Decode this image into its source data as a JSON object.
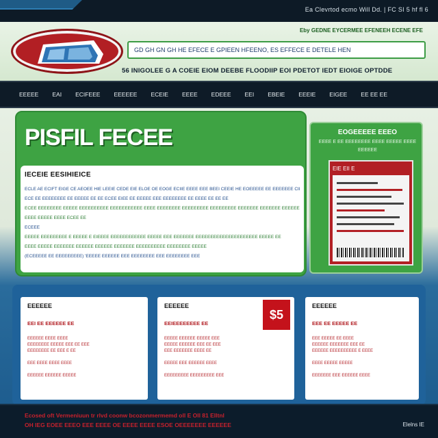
{
  "topbar": {
    "links": "Ea Clevrtod ecmo Will Dd. | FC SI 5 hf fl 6"
  },
  "header": {
    "tagline": "Eby GEDNE EYCERMEE EFENEEH ECENE EFE",
    "search_text": "GD GH GN GH HE EFECE E GPIEEN HFEENO, ES EFFECE E DETELE HEN",
    "slogan": "56 INIGOLEE G A COEIE EIOM DEEBE FLOODIIP EOI PDETOT IEDT EIOIGE OPTDDE"
  },
  "nav": {
    "items": [
      "EEEEE",
      "EAI",
      "ECIFEEE",
      "EEEEEE",
      "ECEIE",
      "EEEE",
      "EDEEE",
      "EEI",
      "EBEIE",
      "EEEIE",
      "EIGEE",
      "EE EE EE"
    ]
  },
  "hero": {
    "title": "PISFIL FECEE",
    "heading": "IECEIE EESIHIEICE",
    "para1": "ECLE AE ECIFT EIGE CE AEOEE HIE LEEIE CEDE EIE ELOE OE EOGE ECIIE EEEE EEE BEEI CEEIE HE EOEEEEE EE EEEEEEE CIEE ECEE EEEEE EEE EEEEEEEE EEE EE",
    "para2": "ECE EE EEEEEEEE EE EEEEE EE EE ECEE EIEE EE EEEEE EEE EEEEEEEE EE EEEE EE EE EE",
    "para3": "ECEE EEEEEEEE EEEEE EEEEEEEEEE EEEEEEEEEEE EEEE EEEEEEEE EEEEEEEEE EEEEEEEEE EEEEEEE EEEEEEE EEEEEE EEEE ECE EEEEEEE EEEEEE",
    "para4": "EEEE EEEEE EEEE ECEE EE",
    "para5": "ECEEE",
    "para6": "EEEEE EEEEEEEEE E EEEEE E EIEEEE EEEEEEEEEEEE EEEEE EEE EEEEEEE EEEEEEEEEEEEEEEEEEEEE EEEEE EE",
    "para7": "EEEE EEEEE EEEEEEE EEEEEE EEEEEE EEEEEEE EEEEEEEEEE EEEEEEEE EEEEE",
    "para8": "(ECEEEEE EE EEEEEEEEE) 'EEEEE EEEEEE EEE EEEEEEEE EEE EEEEEEEE EEE"
  },
  "promo": {
    "title": "EOGEEEEE EEEO",
    "sub": "EEEE E EE EEEEEEEE EEEE EEEEE EEEE EEEEEE",
    "doc_title": "EIE EII E"
  },
  "cards": [
    {
      "title": "EEEEEE",
      "sub": "EEI EE EEEEEE EE",
      "lines": [
        "EEEEEE EEEE EEEE",
        "EEEEEEEE EEEEE EEE EE EEE",
        "EEEEEEEE EE EEE E EE",
        "",
        "EEE EEEE EEEE EEEE",
        "",
        "EEEEEE EEEEEE EEEEE"
      ]
    },
    {
      "title": "EEEEEE",
      "sub": "EEIEEEEEEEE EE",
      "price": "$5",
      "lines": [
        "EEEEE EEEEEE EEEEE EEE",
        "EEEEE EEEEEE EEE EE EEE",
        "EEE EEEEEEE EEEE EE",
        "",
        "EEEEE EEE EEEEEE EEEE",
        "",
        "EEEEEEEEE EEEEEEEEE EEE"
      ]
    },
    {
      "title": "EEEEEE",
      "sub": "EEE EE EEEEE EE",
      "lines": [
        "EEE EEEEE EE EEEE",
        "EEEEEE EEEEEEE EEE EE",
        "EEEEEE EEEEEEEEEE E EEEE",
        "",
        "EEEE EEEEE EEEEE",
        "",
        "EEEEEEE EEE EEEEEE EEEE"
      ]
    }
  ],
  "footer": {
    "line1": "Ecosed oft Vermeniuun tr rlvd coonw bcozonmermemd oll E Oll 81 Elltnl",
    "line2": "OH IEG EOEE EEEO EEE EEEE OE EEEE EEEE ESOE OEEEEEEE EEEEEE",
    "right": "Elelns IE"
  },
  "colors": {
    "green": "#3ea343",
    "red": "#b21f24",
    "navy": "#0e1b27",
    "blue": "#1f629a"
  }
}
